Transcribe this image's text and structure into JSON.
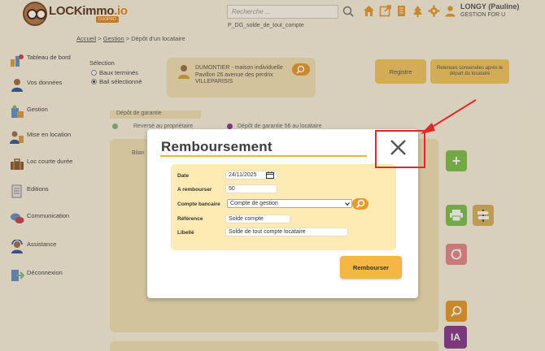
{
  "header": {
    "logo_text": "LOCKimmo",
    "logo_suffix": ".io",
    "logo_sub": "DUOPRO",
    "search_placeholder": "Recherche ...",
    "page_code": "P_DG_solde_de_tout_compte",
    "user_name": "LONGY (Pauline)",
    "user_role": "GESTION FOR U"
  },
  "breadcrumb": {
    "items": [
      "Accueil",
      "Gestion",
      "Dépôt d'un locataire"
    ],
    "separator": ">"
  },
  "sidebar": {
    "items": [
      {
        "label": "Tableau de bord",
        "icon": "dashboard-icon"
      },
      {
        "label": "Vos données",
        "icon": "person-icon"
      },
      {
        "label": "Gestion",
        "icon": "gestion-icon"
      },
      {
        "label": "Mise en location",
        "icon": "rental-icon"
      },
      {
        "label": "Loc courte durée",
        "icon": "suitcase-icon"
      },
      {
        "label": "Editions",
        "icon": "document-icon"
      },
      {
        "label": "Communication",
        "icon": "chat-icon"
      },
      {
        "label": "Assistance",
        "icon": "support-icon"
      },
      {
        "label": "Déconnexion",
        "icon": "logout-icon"
      }
    ]
  },
  "selection": {
    "title": "Sélection",
    "options": [
      {
        "label": "Baux terminés",
        "checked": false
      },
      {
        "label": "Bail sélectionné",
        "checked": true
      }
    ]
  },
  "owner_card": {
    "text": "DUMONTIER - maison individuelle Pavillon 26 avenue des perdrix VILLEPARISIS"
  },
  "actions": {
    "registre": "Registre",
    "retenues": "Retenues conservées après le départ du locataire"
  },
  "depot": {
    "tab_label": "Dépôt de garantie",
    "line1": "Reversé au propriétaire",
    "line2": "Dépôt de garantie 56 au locataire",
    "bilan_label": "Bilan"
  },
  "modal": {
    "title": "Remboursement",
    "fields": {
      "date_label": "Date",
      "date_value": "24/11/2025",
      "amount_label": "A rembourser",
      "amount_value": "50",
      "bank_label": "Compte bancaire",
      "bank_value": "Compte de gestion",
      "reference_label": "Référence",
      "reference_value": "Solde compte",
      "libelle_label": "Libellé",
      "libelle_value": "Solde de tout compte locataire"
    },
    "submit_label": "Rembourser"
  },
  "fabs": {
    "ia_label": "IA",
    "add_label": "+"
  },
  "colors": {
    "accent": "#f5b743",
    "highlight": "#e0272c",
    "panel": "#fdebb3",
    "background": "#fbf2dc"
  }
}
